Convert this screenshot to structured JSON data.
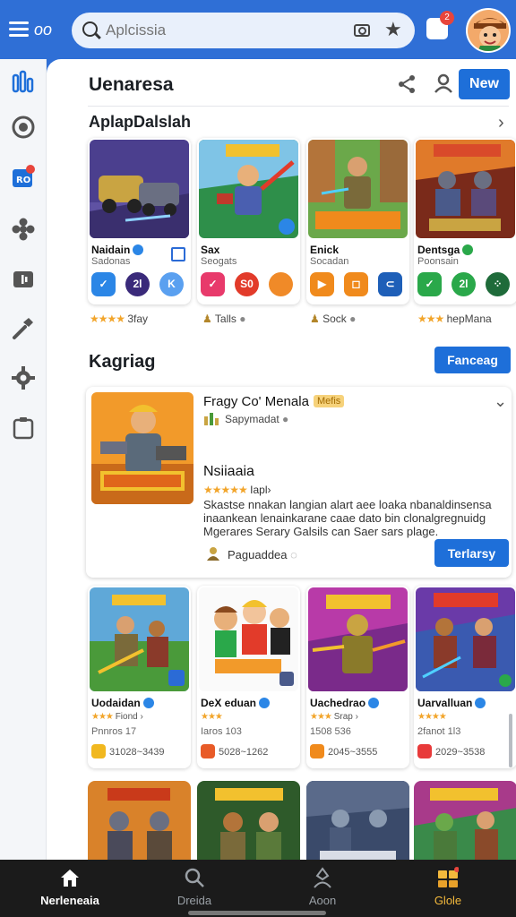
{
  "topbar": {
    "tag": "oo",
    "search_placeholder": "Aplcissia",
    "notif_count": "2"
  },
  "header": {
    "title": "Uenaresa",
    "new_label": "New",
    "section_title": "AplapDalslah"
  },
  "top_cards": [
    {
      "name": "Naidain",
      "sub": "Sadonas",
      "verified": "blue",
      "apps": [
        "✓",
        "2l",
        "K"
      ],
      "app_colors": [
        "#2b86e6",
        "#3a2a7a",
        "#5aa0f0"
      ],
      "below": "3fay",
      "below_stars": "★★★★",
      "below_type": "stars"
    },
    {
      "name": "Sax",
      "sub": "Seogats",
      "verified": "",
      "apps": [
        "✓",
        "S0",
        ""
      ],
      "app_colors": [
        "#e83a6b",
        "#e23b2a",
        "#f08a28"
      ],
      "below": "Talls",
      "below_type": "icon"
    },
    {
      "name": "Enick",
      "sub": "Socadan",
      "verified": "",
      "apps": [
        "▶",
        "◻",
        "⊂"
      ],
      "app_colors": [
        "#f08a1c",
        "#f08a1c",
        "#1e5fb8"
      ],
      "below": "Sock",
      "below_type": "icon"
    },
    {
      "name": "Dentsga",
      "sub": "Poonsain",
      "verified": "green",
      "apps": [
        "✓",
        "2l",
        "⁘"
      ],
      "app_colors": [
        "#2aa84a",
        "#2aa84a",
        "#1f6b3a"
      ],
      "below": "hepMana",
      "below_stars": "★★★",
      "below_type": "stars"
    }
  ],
  "section2": {
    "title": "Kagriag",
    "forecast_label": "Fanceag"
  },
  "feature": {
    "title": "Fragy Co' Menala",
    "badge": "Mefis",
    "sub": "Sapymadat",
    "name": "Nsiiaaia",
    "stars": "★★★★★",
    "rating_text": "Iapl›",
    "description": "Skastse nnakan langian alart aee loaka nbanaldinsensa inaankean lenainkarane caae dato bin clonalgregnuidg Mgerares Serary Galsils can Saer sars plage.",
    "footer": "Paguaddea",
    "button": "Terlarsy"
  },
  "grid_cards": [
    {
      "name": "Uodaidan",
      "stars": "★★★",
      "rating": "Fiond ›",
      "code": "Pnnros 17",
      "range": "31028~3439",
      "icon_color": "#f1b81f"
    },
    {
      "name": "DeX eduan",
      "stars": "★★★",
      "rating": "",
      "code": "Iaros 103",
      "range": "5028~1262",
      "icon_color": "#e85b28"
    },
    {
      "name": "Uachedrao",
      "stars": "★★★",
      "rating": "Srap ›",
      "code": "1508 536",
      "range": "2045~3555",
      "icon_color": "#f08a1c"
    },
    {
      "name": "Uarvalluan",
      "stars": "★★★★",
      "rating": "",
      "code": "2fanot 1l3",
      "range": "2029~3538",
      "icon_color": "#e83a3a"
    }
  ],
  "bottom_nav": [
    {
      "label": "Nerleneaia",
      "icon": "home-icon"
    },
    {
      "label": "Dreida",
      "icon": "search-icon"
    },
    {
      "label": "Aoon",
      "icon": "person-icon"
    },
    {
      "label": "Glole",
      "icon": "grid-icon"
    }
  ],
  "colors": {
    "brand": "#2f6fd6",
    "accent": "#1e6fd9",
    "gold": "#f3b93c",
    "nav_bg": "#1b1b1b"
  }
}
